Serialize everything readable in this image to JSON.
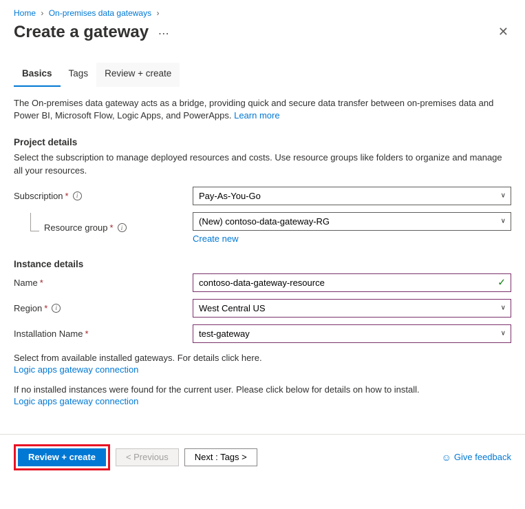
{
  "breadcrumb": {
    "home": "Home",
    "gateways": "On-premises data gateways"
  },
  "page": {
    "title": "Create a gateway"
  },
  "tabs": {
    "basics": "Basics",
    "tags": "Tags",
    "review": "Review + create"
  },
  "intro": {
    "text": "The On-premises data gateway acts as a bridge, providing quick and secure data transfer between on-premises data and Power BI, Microsoft Flow, Logic Apps, and PowerApps. ",
    "learn_more": "Learn more"
  },
  "project": {
    "header": "Project details",
    "desc": "Select the subscription to manage deployed resources and costs. Use resource groups like folders to organize and manage all your resources.",
    "subscription_label": "Subscription",
    "subscription_value": "Pay-As-You-Go",
    "rg_label": "Resource group",
    "rg_value": "(New) contoso-data-gateway-RG",
    "create_new": "Create new"
  },
  "instance": {
    "header": "Instance details",
    "name_label": "Name",
    "name_value": "contoso-data-gateway-resource",
    "region_label": "Region",
    "region_value": "West Central US",
    "install_label": "Installation Name",
    "install_value": "test-gateway"
  },
  "help": {
    "available_text": "Select from available installed gateways. For details click here.",
    "none_text": "If no installed instances were found for the current user. Please click below for details on how to install.",
    "link_text": "Logic apps gateway connection"
  },
  "footer": {
    "review": "Review + create",
    "previous": "< Previous",
    "next": "Next : Tags >",
    "feedback": "Give feedback"
  }
}
